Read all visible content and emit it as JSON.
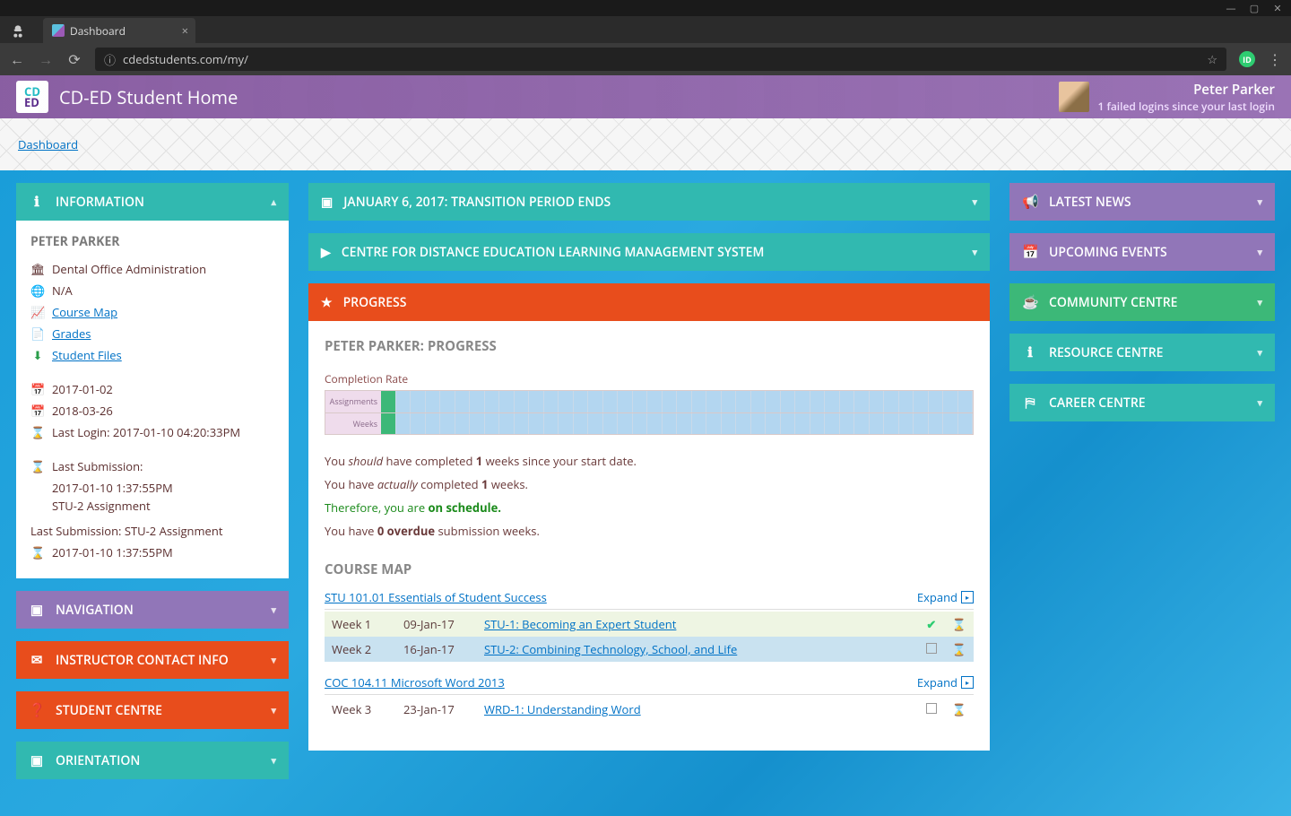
{
  "window": {
    "tab_title": "Dashboard",
    "url": "cdedstudents.com/my/"
  },
  "topbar": {
    "site_title": "CD-ED Student Home",
    "user_name": "Peter Parker",
    "failed_login_msg": "1 failed logins since your last login"
  },
  "breadcrumb": {
    "dashboard": "Dashboard"
  },
  "left": {
    "information": {
      "title": "INFORMATION",
      "student_name": "PETER PARKER",
      "program": "Dental Office Administration",
      "na": "N/A",
      "course_map": "Course Map",
      "grades": "Grades",
      "student_files": "Student Files",
      "date1": "2017-01-02",
      "date2": "2018-03-26",
      "last_login_label": "Last Login: 2017-01-10 04:20:33PM",
      "last_submission_label": "Last Submission:",
      "last_submission_time": "2017-01-10 1:37:55PM",
      "last_submission_item": "STU-2 Assignment",
      "last_submission_full": "Last Submission: STU-2 Assignment",
      "last_submission_time2": "2017-01-10 1:37:55PM"
    },
    "navigation": {
      "title": "NAVIGATION"
    },
    "instructor": {
      "title": "INSTRUCTOR CONTACT INFO"
    },
    "student_centre": {
      "title": "STUDENT CENTRE"
    },
    "orientation": {
      "title": "ORIENTATION"
    }
  },
  "center": {
    "announcement": "JANUARY 6, 2017: TRANSITION PERIOD ENDS",
    "lms": "CENTRE FOR DISTANCE EDUCATION LEARNING MANAGEMENT SYSTEM",
    "progress_title": "PROGRESS",
    "progress_heading": "PETER PARKER: PROGRESS",
    "completion_rate": "Completion Rate",
    "row_assignments": "Assignments",
    "row_weeks": "Weeks",
    "p1a": "You ",
    "p1b": "should",
    "p1c": " have completed ",
    "p1d": "1",
    "p1e": " weeks since your start date.",
    "p2a": "You have ",
    "p2b": "actually",
    "p2c": " completed ",
    "p2d": "1",
    "p2e": " weeks.",
    "p3a": "Therefore, you are ",
    "p3b": "on schedule.",
    "p4a": "You have ",
    "p4b": "0 overdue",
    "p4c": " submission weeks.",
    "course_map_title": "COURSE MAP",
    "expand": "Expand",
    "courses": [
      {
        "name": "STU 101.01 Essentials of Student Success",
        "weeks": [
          {
            "wk": "Week 1",
            "date": "09-Jan-17",
            "title": "STU-1: Becoming an Expert Student",
            "done": true,
            "alt": 0
          },
          {
            "wk": "Week 2",
            "date": "16-Jan-17",
            "title": "STU-2: Combining Technology, School, and Life",
            "done": false,
            "alt": 1
          }
        ]
      },
      {
        "name": "COC 104.11 Microsoft Word 2013",
        "weeks": [
          {
            "wk": "Week 3",
            "date": "23-Jan-17",
            "title": "WRD-1: Understanding Word",
            "done": false,
            "alt": 2
          }
        ]
      }
    ]
  },
  "right": {
    "latest_news": "LATEST NEWS",
    "upcoming": "UPCOMING EVENTS",
    "community": "COMMUNITY CENTRE",
    "resource": "RESOURCE CENTRE",
    "career": "CAREER CENTRE"
  },
  "chart_data": {
    "type": "bar",
    "title": "Completion Rate",
    "series": [
      {
        "name": "Assignments",
        "completed": 1,
        "total": 40
      },
      {
        "name": "Weeks",
        "completed": 1,
        "total": 40
      }
    ],
    "xlabel": "",
    "ylabel": ""
  }
}
